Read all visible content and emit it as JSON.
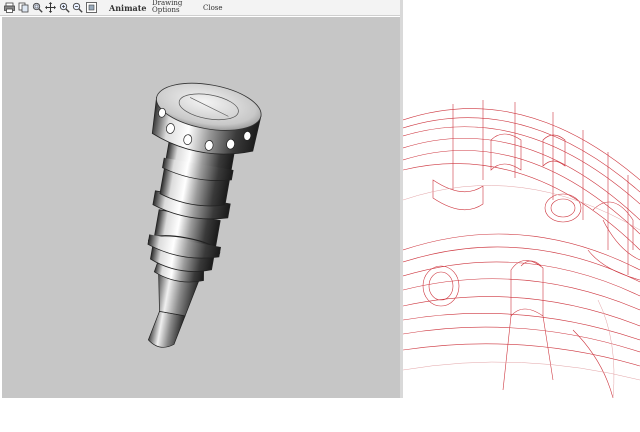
{
  "toolbar": {
    "icons": [
      "print-icon",
      "copy-icon",
      "zoom-area-icon",
      "pan-icon",
      "zoom-in-icon",
      "zoom-out-icon",
      "fit-view-icon"
    ],
    "animate_label": "Animate",
    "drawing_options_line1": "Drawing",
    "drawing_options_line2": "Options",
    "close_label": "Close"
  },
  "colors": {
    "viewport_bg": "#c6c6c6",
    "wireframe_stroke": "#c8202a",
    "toolbar_bg": "#f3f3f3"
  }
}
